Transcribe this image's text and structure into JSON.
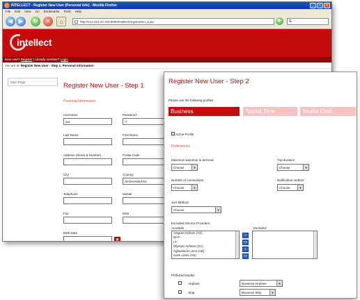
{
  "browser": {
    "title": "INTELLECT - Register New User (Personal Info) - Mozilla Firefox",
    "menu": [
      "File",
      "Edit",
      "View",
      "Go",
      "Bookmarks",
      "Tools",
      "Help"
    ],
    "url": "http://212.251.40.163:8080/intellect/registration_1.jsp",
    "search_label": "G"
  },
  "site": {
    "logo": "intellect",
    "userbar_prefix": "New user?",
    "userbar_register": "Register",
    "userbar_mid": "| Already member?",
    "userbar_login": "Login",
    "breadcrumb_prefix": "You are at:",
    "breadcrumb_path": "Register New User - Step 1. Personal Information",
    "left_menu": "Main Page"
  },
  "step1": {
    "title": "Register New User - Step 1",
    "section": "Personal Information",
    "fields": {
      "username": {
        "label": "Username",
        "value": "pra"
      },
      "password": {
        "label": "Password",
        "value": "**"
      },
      "last_name": {
        "label": "Last Name",
        "value": ""
      },
      "first_name": {
        "label": "First Name",
        "value": ""
      },
      "address": {
        "label": "Address (Street & Number)",
        "value": ""
      },
      "postal_code": {
        "label": "Postal Code",
        "value": ""
      },
      "city": {
        "label": "City",
        "value": ""
      },
      "country": {
        "label": "Country",
        "value": "AFGHANISTAN"
      },
      "telephone": {
        "label": "Telephone",
        "value": ""
      },
      "mobile": {
        "label": "Mobile",
        "value": ""
      },
      "fax": {
        "label": "Fax",
        "value": ""
      },
      "email": {
        "label": "EMa",
        "value": ""
      },
      "birth_date": {
        "label": "Birth Date",
        "value": ""
      }
    }
  },
  "step2": {
    "title": "Register New User - Step 2",
    "instructions": "Please use the following profiles",
    "tabs": [
      "Business",
      "Tourist Time",
      "Tourist Cost"
    ],
    "active_profile_label": "Active Profile",
    "preferences_label": "Preferences",
    "max_wait_label": "Maximum wait time in terminal",
    "max_wait_value": "Choose",
    "trip_duration_label": "Trip duration",
    "trip_duration_value": "Choose",
    "connections_label": "Number of connections",
    "connections_value": "Choose",
    "notification_label": "Notification method",
    "notification_value": "Choose",
    "sort_label": "Sort Method",
    "sort_value": "Choose",
    "excluded_label": "Excluded Service Providers",
    "available_label": "Available",
    "excluded_col_label": "Excluded",
    "available_items": [
      "Aegean Airlines (A3)",
      "DHY",
      "LT",
      "Olympic Airlines (OA)",
      "Aglauitinos Lines (AD)",
      "Anek Lines (AN)"
    ],
    "move_buttons": [
      ">",
      ">>",
      "<",
      "<<"
    ],
    "preferred_modes_label": "Preferred Modes",
    "modes": [
      {
        "label": "Airplane",
        "value": "Business Airplane"
      },
      {
        "label": "Ship",
        "value": "Business Ship"
      }
    ]
  }
}
